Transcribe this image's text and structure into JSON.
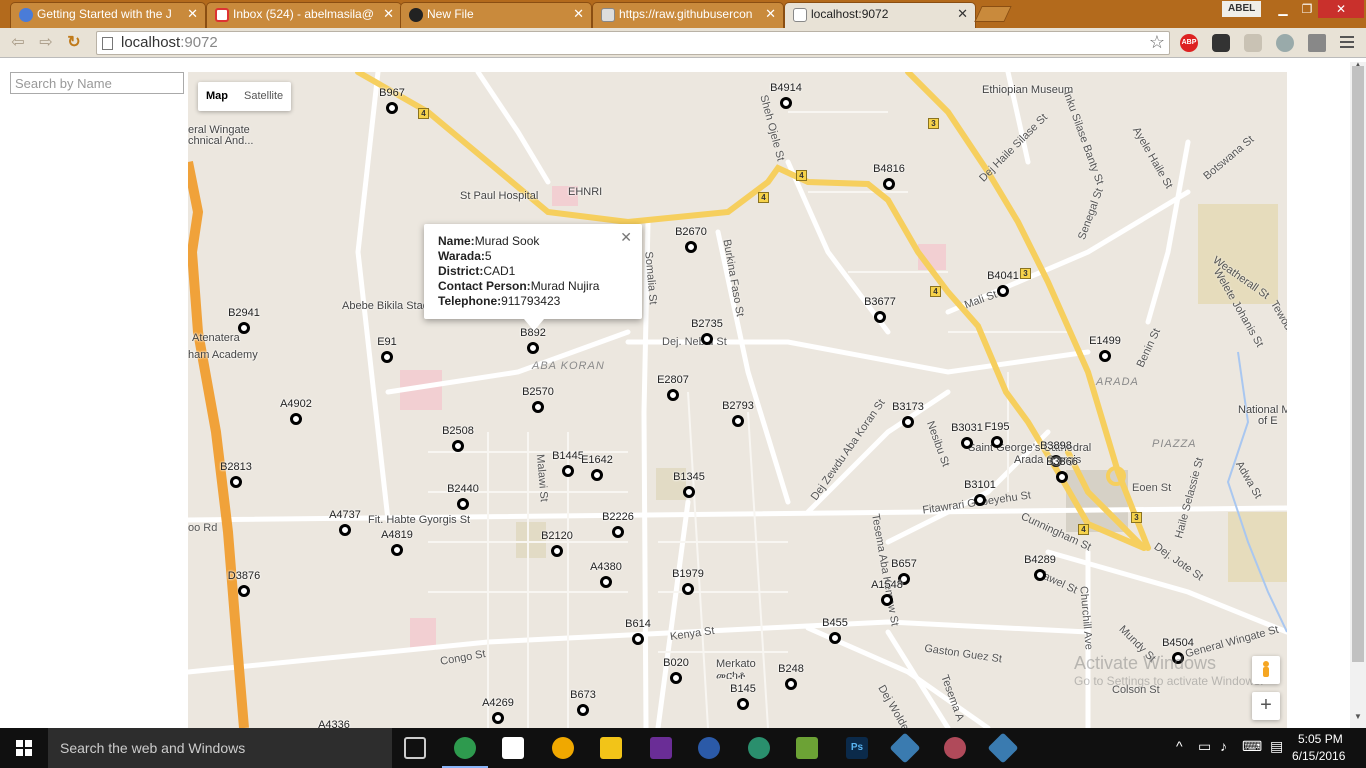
{
  "browser": {
    "tabs": [
      {
        "title": "Getting Started with the J",
        "favicon": "browser-icon"
      },
      {
        "title": "Inbox (524) - abelmasila@",
        "favicon": "gmail-icon"
      },
      {
        "title": "New File",
        "favicon": "github-icon"
      },
      {
        "title": "https://raw.githubusercon",
        "favicon": "page-icon"
      },
      {
        "title": "localhost:9072",
        "favicon": "page-icon",
        "active": true
      }
    ],
    "user": "ABEL",
    "url_host": "localhost",
    "url_port": ":9072",
    "extensions": [
      {
        "name": "adblock-icon",
        "label": "ABP"
      }
    ]
  },
  "page": {
    "search_placeholder": "Search by Name",
    "map_type": {
      "map": "Map",
      "satellite": "Satellite",
      "selected": "Map"
    }
  },
  "info_window": {
    "rows": [
      {
        "label": "Name:",
        "value": "Murad Sook"
      },
      {
        "label": "Warada:",
        "value": "5"
      },
      {
        "label": "District:",
        "value": "CAD1"
      },
      {
        "label": "Contact Person:",
        "value": "Murad Nujira"
      },
      {
        "label": "Telephone:",
        "value": "911793423"
      }
    ]
  },
  "markers": [
    "B967",
    "B4914",
    "B4816",
    "B2670",
    "B4041",
    "B3677",
    "B2735",
    "E1499",
    "B2941",
    "E91",
    "B892",
    "E2807",
    "B2570",
    "A4902",
    "B2793",
    "B3173",
    "B3031",
    "F195",
    "B2508",
    "B1445",
    "E1642",
    "B3898",
    "B3366",
    "B2813",
    "B1345",
    "B3101",
    "B2440",
    "A4737",
    "A4819",
    "B2226",
    "B2120",
    "D3876",
    "A4380",
    "B1979",
    "B657",
    "A1548",
    "B4289",
    "B614",
    "B455",
    "B4504",
    "B020",
    "B248",
    "B673",
    "B145",
    "A4269",
    "A4336"
  ],
  "map_labels": {
    "places": [
      "Ethiopian Museum",
      "St Paul Hospital",
      "EHNRI",
      "eral Wingate",
      "chnical And...",
      "Abebe Bikila Stad",
      "Atenatera",
      "ham Academy",
      "Fit. Habte Gyorgis St",
      "Saint George's Cathedral",
      "Arada Giorgis",
      "National M",
      "of E",
      "Merkato",
      "መርካቶ"
    ],
    "streets": [
      "Sheh Ojele St",
      "Dej Haile Silase St",
      "Inku Silase Banty St",
      "Senegal St",
      "Ayele Haile St",
      "Botswana St",
      "Weatherall St",
      "Welete Johanis St",
      "Tewodros St",
      "Benin St",
      "Mali St",
      "Somalia St",
      "Burkina Faso St",
      "Dej. Nebiu St",
      "Dej Zewdu Aba Koran St",
      "Nesibu St",
      "Fitawrari Gebeyehu St",
      "Cunningham St",
      "Eoen St",
      "Haile Selassie St",
      "Adwa St",
      "Malawi St",
      "Kenya St",
      "Congo St",
      "Gaston Guez St",
      "Tesema Aba Kemaw St",
      "Churchill Ave",
      "Dej. Jote St",
      "Mundy St",
      "General Wingate St",
      "Colson St",
      "Yawel St",
      "Dej Wolde",
      "oo Rd",
      "Tesema A"
    ],
    "districts": [
      "ABA KORAN",
      "ARADA",
      "PIAZZA"
    ],
    "route_numbers": [
      "4",
      "3"
    ]
  },
  "watermark": {
    "title": "Activate Windows",
    "subtitle": "Go to Settings to activate Windows."
  },
  "taskbar": {
    "search_text": "Search the web and Windows",
    "time": "5:05 PM",
    "date": "6/15/2016",
    "apps": [
      "task-view",
      "chrome",
      "store",
      "chrome-canary",
      "file-explorer",
      "visual-studio",
      "firefox",
      "atom",
      "android-studio",
      "photoshop",
      "git",
      "network-tool",
      "git-2"
    ]
  },
  "colors": {
    "tabstrip": "#b36a1c",
    "map_bg": "#ece7df",
    "road_major": "#f6cf5e",
    "road_orange": "#f0a23a",
    "marker": "#000000"
  }
}
